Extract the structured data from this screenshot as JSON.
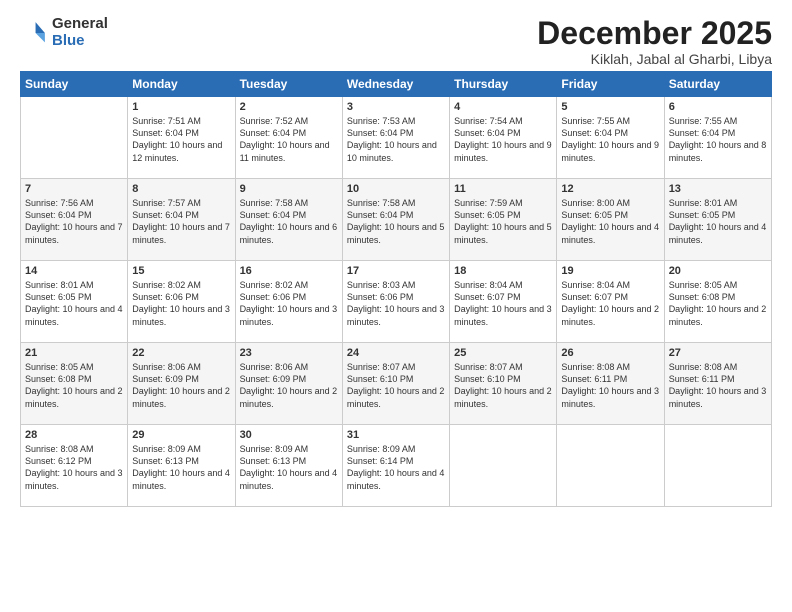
{
  "logo": {
    "general": "General",
    "blue": "Blue"
  },
  "title": "December 2025",
  "location": "Kiklah, Jabal al Gharbi, Libya",
  "days_header": [
    "Sunday",
    "Monday",
    "Tuesday",
    "Wednesday",
    "Thursday",
    "Friday",
    "Saturday"
  ],
  "weeks": [
    [
      {
        "day": "",
        "info": ""
      },
      {
        "day": "1",
        "info": "Sunrise: 7:51 AM\nSunset: 6:04 PM\nDaylight: 10 hours\nand 12 minutes."
      },
      {
        "day": "2",
        "info": "Sunrise: 7:52 AM\nSunset: 6:04 PM\nDaylight: 10 hours\nand 11 minutes."
      },
      {
        "day": "3",
        "info": "Sunrise: 7:53 AM\nSunset: 6:04 PM\nDaylight: 10 hours\nand 10 minutes."
      },
      {
        "day": "4",
        "info": "Sunrise: 7:54 AM\nSunset: 6:04 PM\nDaylight: 10 hours\nand 9 minutes."
      },
      {
        "day": "5",
        "info": "Sunrise: 7:55 AM\nSunset: 6:04 PM\nDaylight: 10 hours\nand 9 minutes."
      },
      {
        "day": "6",
        "info": "Sunrise: 7:55 AM\nSunset: 6:04 PM\nDaylight: 10 hours\nand 8 minutes."
      }
    ],
    [
      {
        "day": "7",
        "info": "Sunrise: 7:56 AM\nSunset: 6:04 PM\nDaylight: 10 hours\nand 7 minutes."
      },
      {
        "day": "8",
        "info": "Sunrise: 7:57 AM\nSunset: 6:04 PM\nDaylight: 10 hours\nand 7 minutes."
      },
      {
        "day": "9",
        "info": "Sunrise: 7:58 AM\nSunset: 6:04 PM\nDaylight: 10 hours\nand 6 minutes."
      },
      {
        "day": "10",
        "info": "Sunrise: 7:58 AM\nSunset: 6:04 PM\nDaylight: 10 hours\nand 5 minutes."
      },
      {
        "day": "11",
        "info": "Sunrise: 7:59 AM\nSunset: 6:05 PM\nDaylight: 10 hours\nand 5 minutes."
      },
      {
        "day": "12",
        "info": "Sunrise: 8:00 AM\nSunset: 6:05 PM\nDaylight: 10 hours\nand 4 minutes."
      },
      {
        "day": "13",
        "info": "Sunrise: 8:01 AM\nSunset: 6:05 PM\nDaylight: 10 hours\nand 4 minutes."
      }
    ],
    [
      {
        "day": "14",
        "info": "Sunrise: 8:01 AM\nSunset: 6:05 PM\nDaylight: 10 hours\nand 4 minutes."
      },
      {
        "day": "15",
        "info": "Sunrise: 8:02 AM\nSunset: 6:06 PM\nDaylight: 10 hours\nand 3 minutes."
      },
      {
        "day": "16",
        "info": "Sunrise: 8:02 AM\nSunset: 6:06 PM\nDaylight: 10 hours\nand 3 minutes."
      },
      {
        "day": "17",
        "info": "Sunrise: 8:03 AM\nSunset: 6:06 PM\nDaylight: 10 hours\nand 3 minutes."
      },
      {
        "day": "18",
        "info": "Sunrise: 8:04 AM\nSunset: 6:07 PM\nDaylight: 10 hours\nand 3 minutes."
      },
      {
        "day": "19",
        "info": "Sunrise: 8:04 AM\nSunset: 6:07 PM\nDaylight: 10 hours\nand 2 minutes."
      },
      {
        "day": "20",
        "info": "Sunrise: 8:05 AM\nSunset: 6:08 PM\nDaylight: 10 hours\nand 2 minutes."
      }
    ],
    [
      {
        "day": "21",
        "info": "Sunrise: 8:05 AM\nSunset: 6:08 PM\nDaylight: 10 hours\nand 2 minutes."
      },
      {
        "day": "22",
        "info": "Sunrise: 8:06 AM\nSunset: 6:09 PM\nDaylight: 10 hours\nand 2 minutes."
      },
      {
        "day": "23",
        "info": "Sunrise: 8:06 AM\nSunset: 6:09 PM\nDaylight: 10 hours\nand 2 minutes."
      },
      {
        "day": "24",
        "info": "Sunrise: 8:07 AM\nSunset: 6:10 PM\nDaylight: 10 hours\nand 2 minutes."
      },
      {
        "day": "25",
        "info": "Sunrise: 8:07 AM\nSunset: 6:10 PM\nDaylight: 10 hours\nand 2 minutes."
      },
      {
        "day": "26",
        "info": "Sunrise: 8:08 AM\nSunset: 6:11 PM\nDaylight: 10 hours\nand 3 minutes."
      },
      {
        "day": "27",
        "info": "Sunrise: 8:08 AM\nSunset: 6:11 PM\nDaylight: 10 hours\nand 3 minutes."
      }
    ],
    [
      {
        "day": "28",
        "info": "Sunrise: 8:08 AM\nSunset: 6:12 PM\nDaylight: 10 hours\nand 3 minutes."
      },
      {
        "day": "29",
        "info": "Sunrise: 8:09 AM\nSunset: 6:13 PM\nDaylight: 10 hours\nand 4 minutes."
      },
      {
        "day": "30",
        "info": "Sunrise: 8:09 AM\nSunset: 6:13 PM\nDaylight: 10 hours\nand 4 minutes."
      },
      {
        "day": "31",
        "info": "Sunrise: 8:09 AM\nSunset: 6:14 PM\nDaylight: 10 hours\nand 4 minutes."
      },
      {
        "day": "",
        "info": ""
      },
      {
        "day": "",
        "info": ""
      },
      {
        "day": "",
        "info": ""
      }
    ]
  ]
}
